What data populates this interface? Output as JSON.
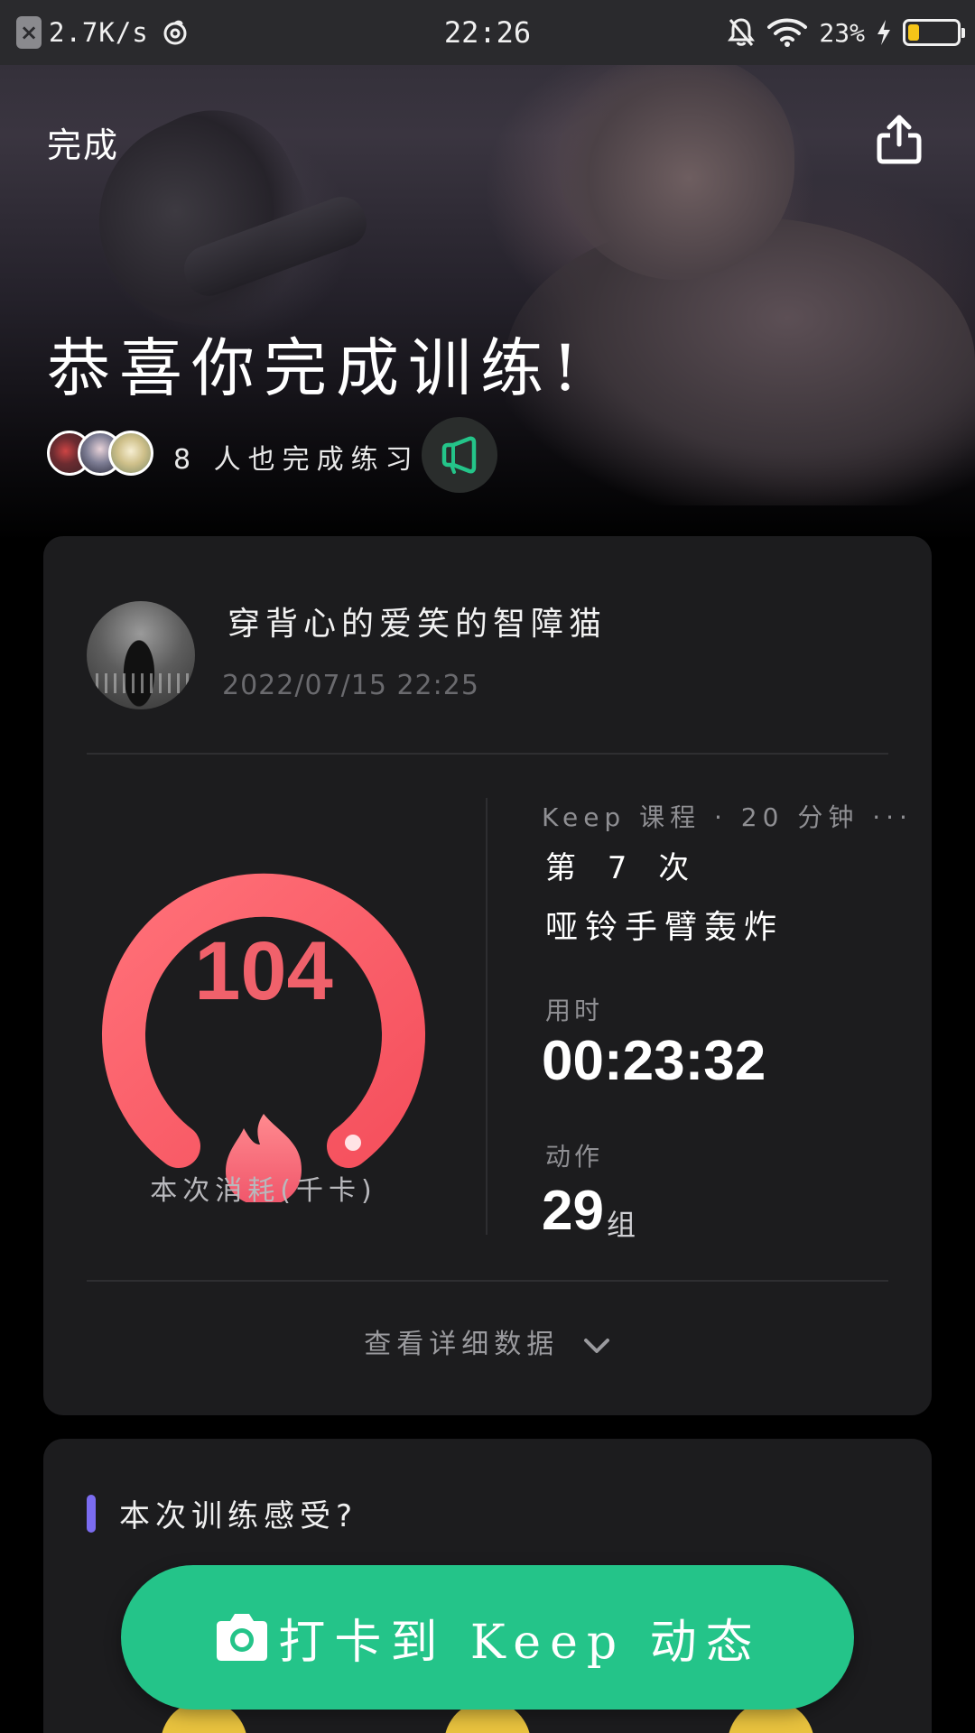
{
  "status_bar": {
    "net_speed": "2.7K/s",
    "time": "22:26",
    "battery_percent": "23%",
    "battery_level": 0.23,
    "battery_color": "#f5c518"
  },
  "header": {
    "done_label": "完成",
    "share_icon": "share-icon"
  },
  "hero": {
    "title": "恭喜你完成训练!",
    "completed_text": "8 人也完成练习",
    "cheer_icon": "megaphone-icon"
  },
  "summary": {
    "username": "穿背心的爱笑的智障猫",
    "datetime": "2022/07/15  22:25",
    "calories": "104",
    "calories_label": "本次消耗(千卡)",
    "course_meta": "Keep 课程 · 20 分钟 ···",
    "session_count": "第 7 次",
    "course_name": "哑铃手臂轰炸",
    "duration_label": "用时",
    "duration": "00:23:32",
    "action_label": "动作",
    "action_count": "29",
    "action_unit": "组",
    "details_link": "查看详细数据",
    "gauge_color": "#f0616b"
  },
  "feedback": {
    "title": "本次训练感受?"
  },
  "checkin": {
    "label": "打卡到 Keep 动态",
    "color": "#24c489"
  }
}
